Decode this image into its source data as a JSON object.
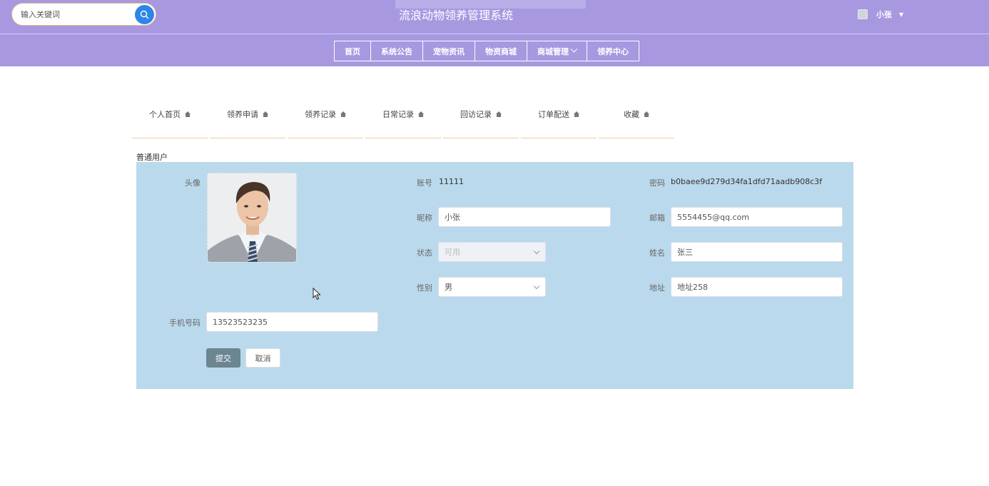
{
  "header": {
    "title": "流浪动物领养管理系统",
    "search": {
      "placeholder": "输入关键词",
      "value": ""
    },
    "user": {
      "name": "小张"
    }
  },
  "nav": [
    "首页",
    "系统公告",
    "宠物资讯",
    "物资商城",
    "商城管理",
    "领养中心"
  ],
  "tabs": [
    "个人首页",
    "领养申请",
    "领养记录",
    "日常记录",
    "回访记录",
    "订单配送",
    "收藏"
  ],
  "role": "普通用户",
  "form": {
    "avatar_label": "头像",
    "account_label": "账号",
    "account_value": "11111",
    "password_label": "密码",
    "password_value": "b0baee9d279d34fa1dfd71aadb908c3f",
    "nickname_label": "昵称",
    "nickname_value": "小张",
    "email_label": "邮箱",
    "email_value": "5554455@qq.com",
    "status_label": "状态",
    "status_value": "可用",
    "name_label": "姓名",
    "name_value": "张三",
    "gender_label": "性别",
    "gender_value": "男",
    "address_label": "地址",
    "address_value": "地址258",
    "phone_label": "手机号码",
    "phone_value": "13523523235",
    "submit_label": "提交",
    "cancel_label": "取消"
  },
  "colors": {
    "header_bg": "#a798e0",
    "panel_bg": "#bad9ec",
    "search_button": "#2e86e8",
    "submit_button": "#6b8591",
    "tab_underline": "#f0c9a4"
  },
  "icons": [
    "search-icon",
    "chevron-down-icon",
    "home-icon",
    "mouse-cursor-icon"
  ]
}
